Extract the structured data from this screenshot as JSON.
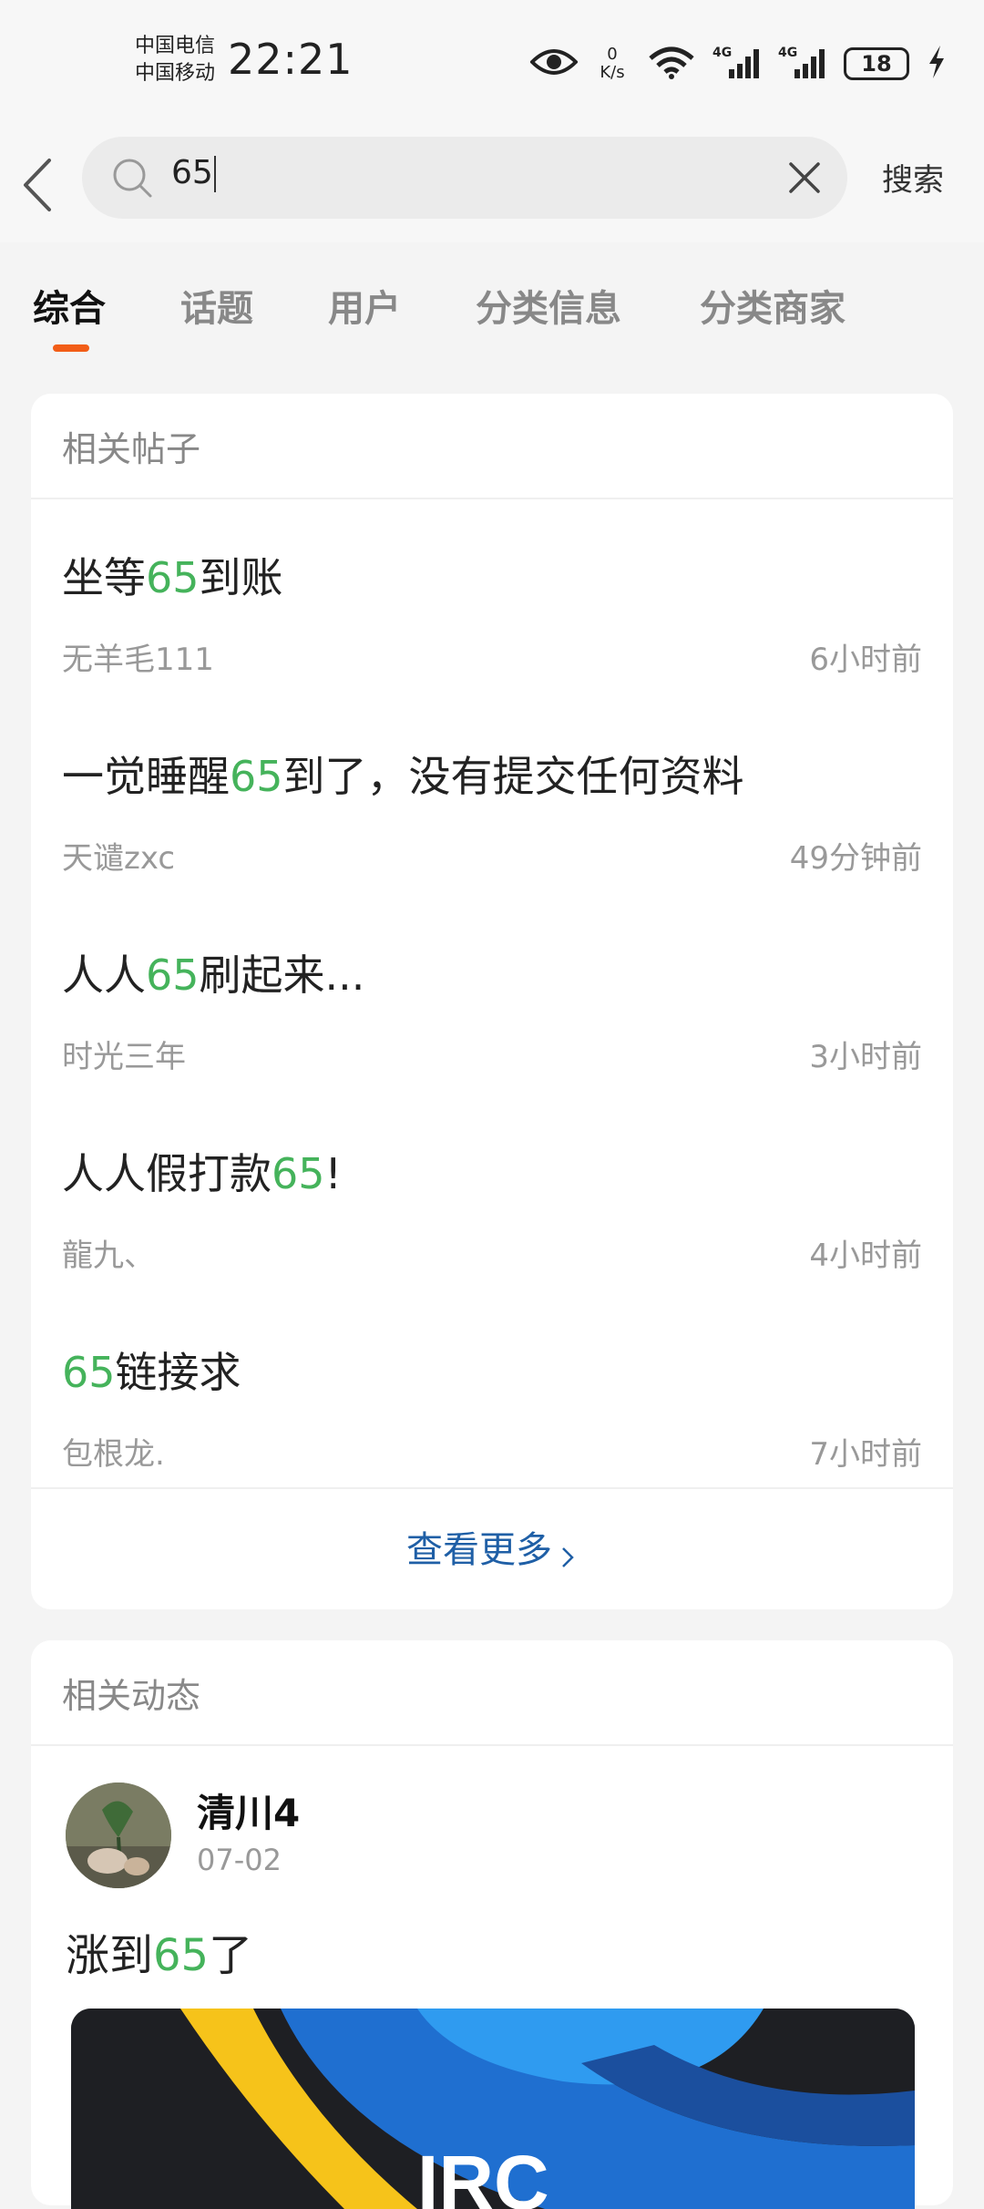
{
  "status_bar": {
    "carrier1": "中国电信",
    "carrier2": "中国移动",
    "time": "22:21",
    "net_speed_value": "0",
    "net_speed_unit": "K/s",
    "signal1_label": "4G",
    "signal2_label": "4G",
    "battery": "18"
  },
  "search": {
    "query": "65",
    "submit_label": "搜索"
  },
  "tabs": [
    "综合",
    "话题",
    "用户",
    "分类信息",
    "分类商家"
  ],
  "active_tab": 0,
  "posts_section": {
    "header": "相关帖子",
    "posts": [
      {
        "title_parts": [
          "坐等",
          "65",
          "到账"
        ],
        "author": "无羊毛111",
        "time": "6小时前"
      },
      {
        "title_parts": [
          "一觉睡醒",
          "65",
          "到了，没有提交任何资料"
        ],
        "author": "天谴zxc",
        "time": "49分钟前"
      },
      {
        "title_parts": [
          "人人",
          "65",
          "刷起来..."
        ],
        "author": "时光三年",
        "time": "3小时前"
      },
      {
        "title_parts": [
          "人人假打款",
          "65",
          "!"
        ],
        "author": "龍九、",
        "time": "4小时前"
      },
      {
        "title_parts": [
          "",
          "65",
          "链接求"
        ],
        "author": "包根龙.",
        "time": "7小时前"
      }
    ],
    "more_label": "查看更多"
  },
  "dynamics_section": {
    "header": "相关动态",
    "user_name": "清川4",
    "date": "07-02",
    "text_parts": [
      "涨到",
      "65",
      "了"
    ],
    "image_text": "IRC"
  },
  "colors": {
    "highlight": "#45b35b",
    "tab_indicator": "#f25d17",
    "link": "#1f5fa6"
  },
  "icons": [
    "back-arrow-icon",
    "search-icon",
    "clear-icon",
    "eye-icon",
    "wifi-icon",
    "signal-icon",
    "battery-icon",
    "charging-bolt-icon",
    "chevron-right-icon"
  ]
}
